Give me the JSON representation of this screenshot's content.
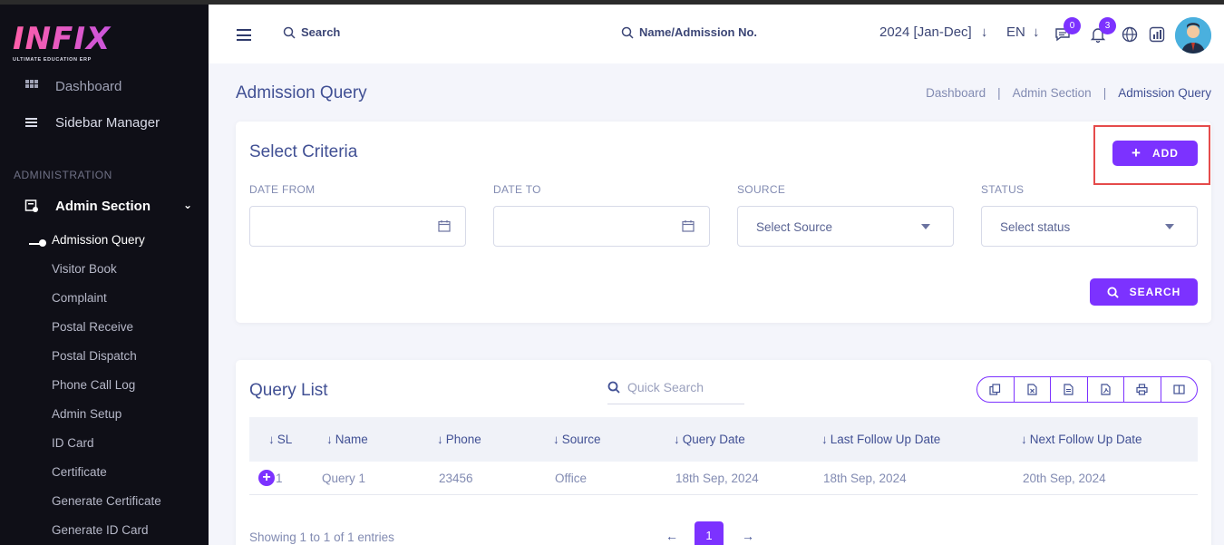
{
  "logo": {
    "main": "INFIX",
    "sub": "ULTIMATE EDUCATION ERP"
  },
  "sidebar": {
    "top_items": [
      {
        "label": "Dashboard",
        "icon": "grid-icon"
      },
      {
        "label": "Sidebar Manager",
        "icon": "list-icon"
      }
    ],
    "section_label": "ADMINISTRATION",
    "group": {
      "label": "Admin Section",
      "icon": "admin-icon"
    },
    "sub_items": [
      "Admission Query",
      "Visitor Book",
      "Complaint",
      "Postal Receive",
      "Postal Dispatch",
      "Phone Call Log",
      "Admin Setup",
      "ID Card",
      "Certificate",
      "Generate Certificate",
      "Generate ID Card"
    ]
  },
  "header": {
    "search_label": "Search",
    "name_search_label": "Name/Admission No.",
    "year": "2024 [Jan-Dec]",
    "lang": "EN",
    "chat_badge": "0",
    "notif_badge": "3"
  },
  "page": {
    "title": "Admission Query",
    "breadcrumb": [
      "Dashboard",
      "Admin Section",
      "Admission Query"
    ]
  },
  "criteria": {
    "title": "Select Criteria",
    "add_label": "ADD",
    "search_label": "SEARCH",
    "fields": {
      "date_from": {
        "label": "DATE FROM",
        "value": ""
      },
      "date_to": {
        "label": "DATE TO",
        "value": ""
      },
      "source": {
        "label": "SOURCE",
        "selected": "Select Source"
      },
      "status": {
        "label": "STATUS",
        "selected": "Select status"
      }
    }
  },
  "query_list": {
    "title": "Query List",
    "quick_search_placeholder": "Quick Search",
    "columns": [
      "SL",
      "Name",
      "Phone",
      "Source",
      "Query Date",
      "Last Follow Up Date",
      "Next Follow Up Date"
    ],
    "rows": [
      {
        "sl": "1",
        "name": "Query 1",
        "phone": "23456",
        "source": "Office",
        "query_date": "18th Sep, 2024",
        "last_follow": "18th Sep, 2024",
        "next_follow": "20th Sep, 2024"
      }
    ],
    "showing": "Showing 1 to 1 of 1 entries",
    "pagination": {
      "prev": "←",
      "current": "1",
      "next": "→"
    }
  },
  "colors": {
    "accent": "#7c32ff",
    "sidebar_bg": "#0f0f17",
    "text": "#415094",
    "highlight": "#e54b4b"
  }
}
